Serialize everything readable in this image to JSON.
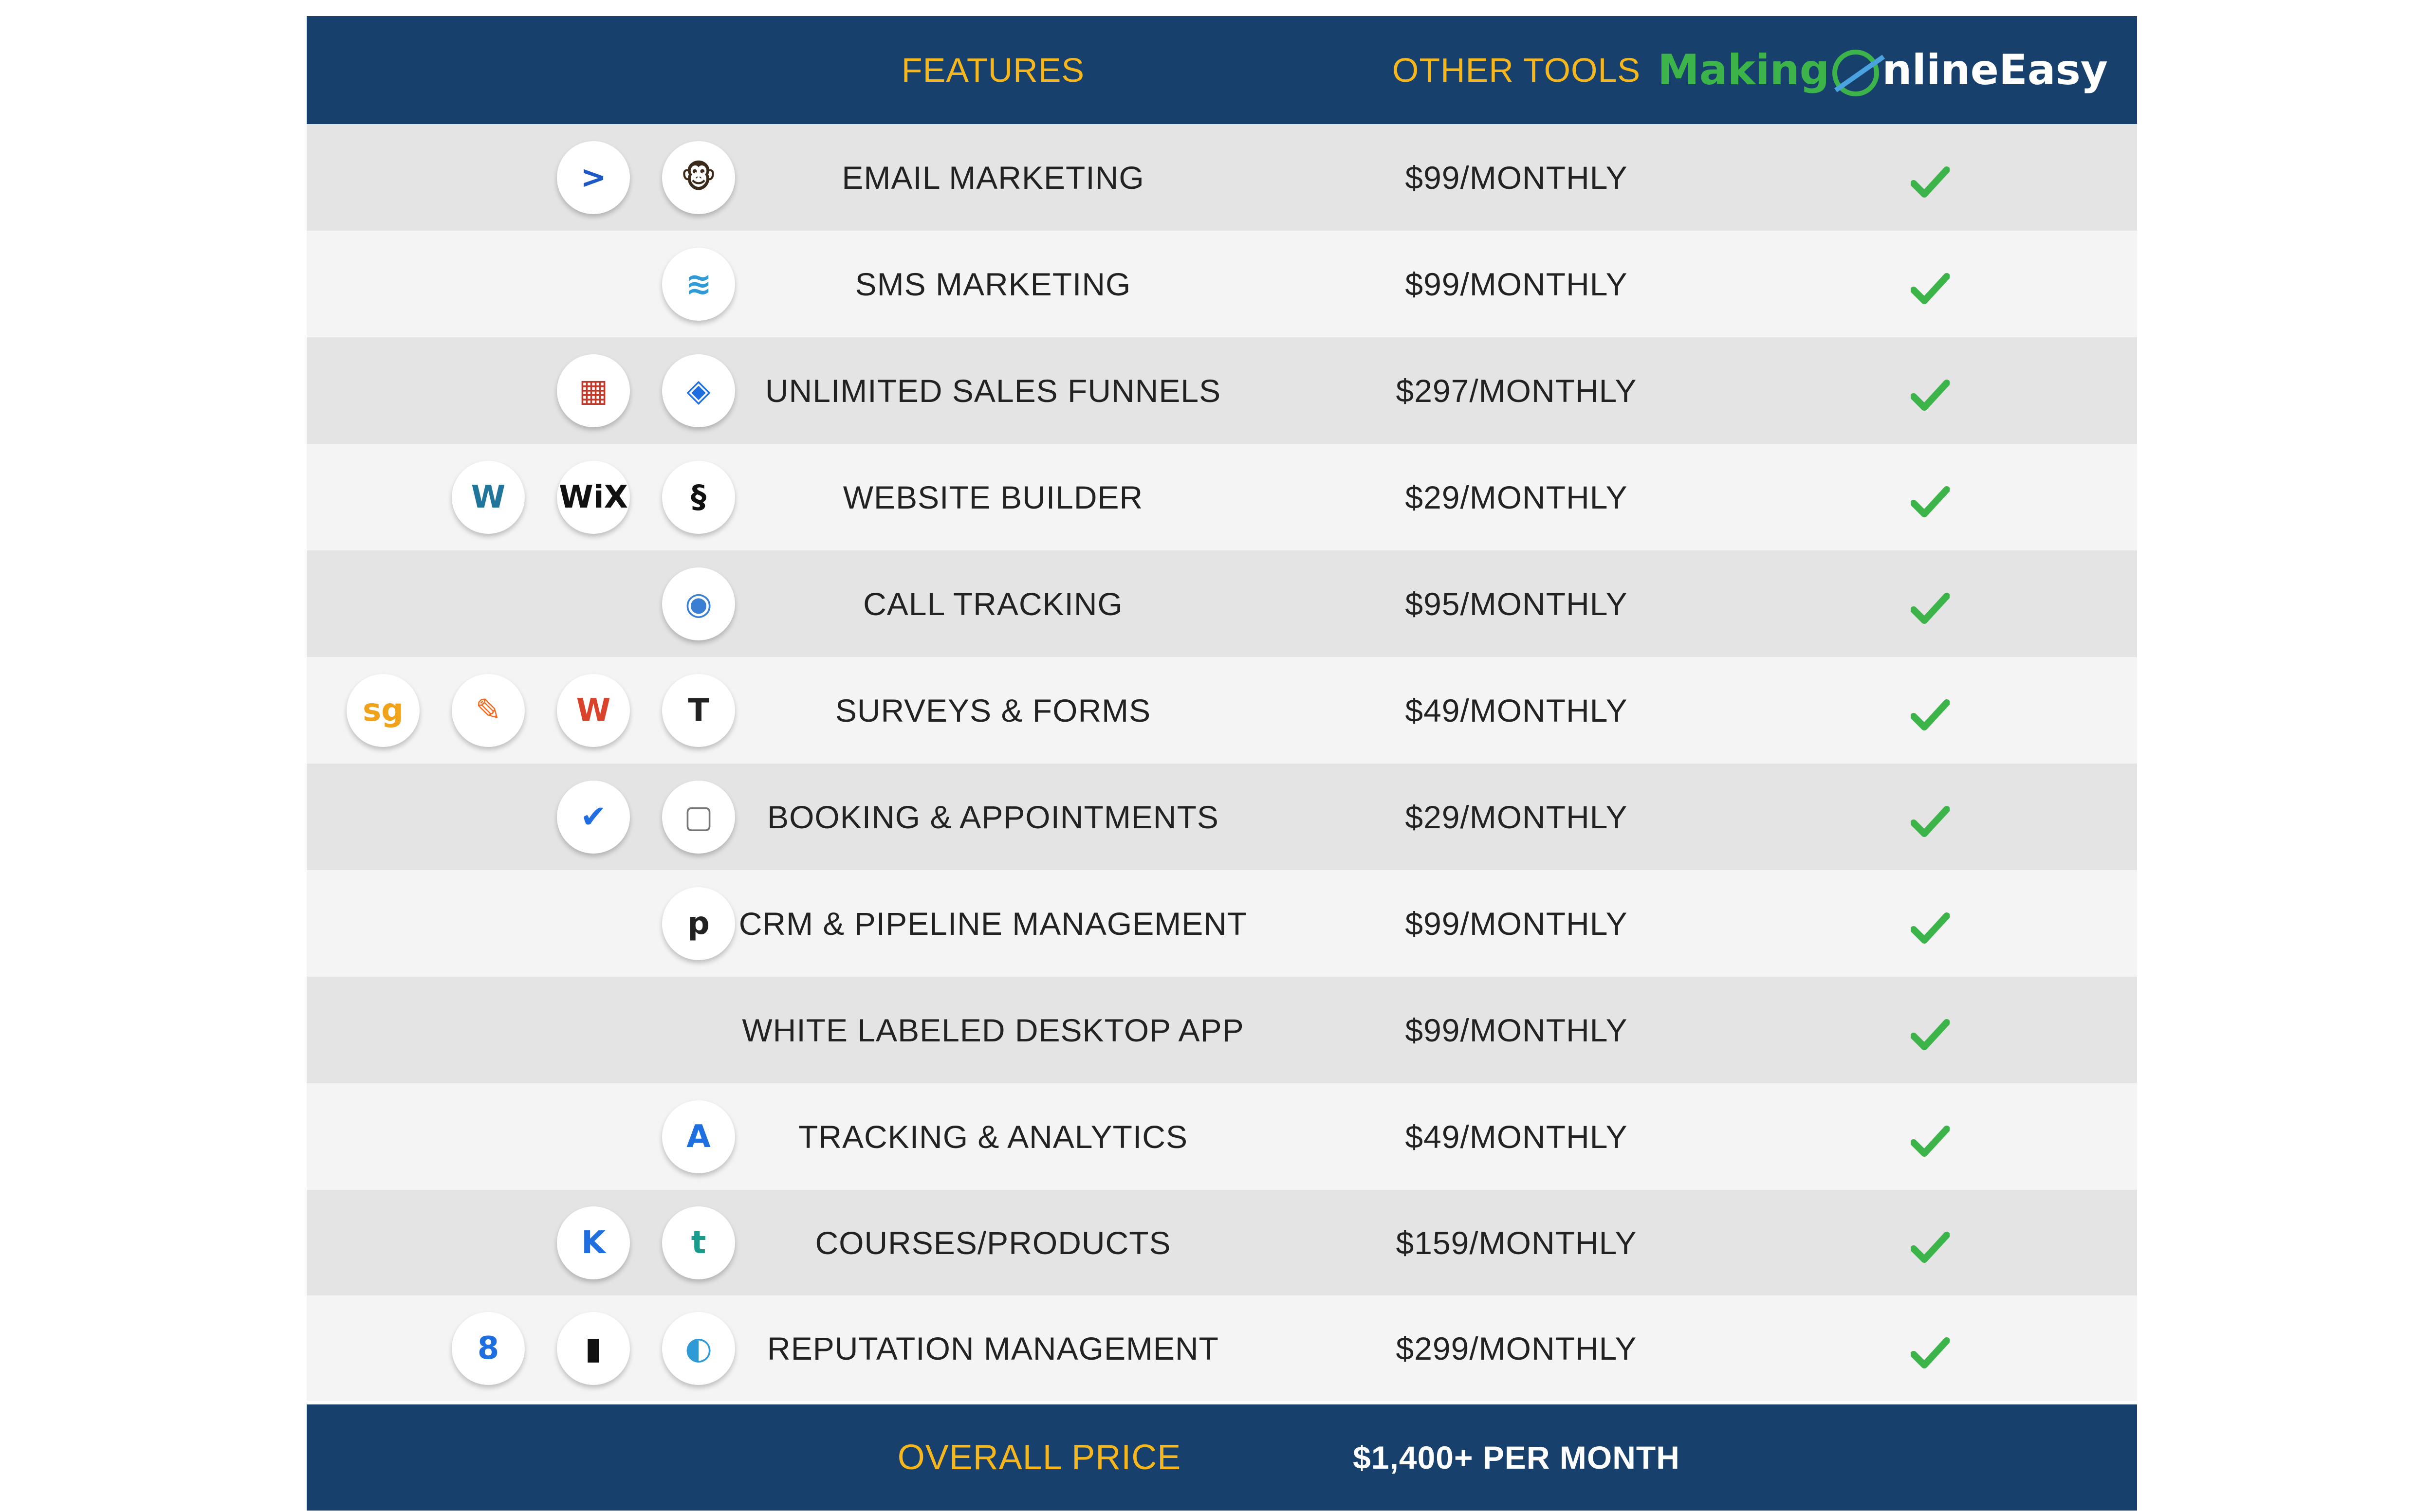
{
  "header": {
    "features_label": "FEATURES",
    "other_tools_label": "OTHER TOOLS",
    "brand": {
      "part1": "Making",
      "part2": "nlineEasy"
    }
  },
  "colors": {
    "header_bg": "#17406c",
    "header_text": "#f5b71d",
    "check": "#3cb449",
    "row_dark": "#e4e4e4",
    "row_light": "#f4f4f4"
  },
  "rows": [
    {
      "feature": "EMAIL MARKETING",
      "price": "$99/MONTHLY",
      "included": true,
      "icons": [
        {
          "name": "activecampaign-icon",
          "glyph": ">",
          "color": "#1d58c6"
        },
        {
          "name": "mailchimp-icon",
          "glyph": "🐵",
          "color": "#3b2a1a"
        }
      ]
    },
    {
      "feature": "SMS MARKETING",
      "price": "$99/MONTHLY",
      "included": true,
      "icons": [
        {
          "name": "layers-chevron-icon",
          "glyph": "≋",
          "color": "#2f9ad6"
        }
      ]
    },
    {
      "feature": "UNLIMITED SALES FUNNELS",
      "price": "$297/MONTHLY",
      "included": true,
      "icons": [
        {
          "name": "clickfunnels-icon",
          "glyph": "▦",
          "color": "#c0392b"
        },
        {
          "name": "layers-icon",
          "glyph": "◈",
          "color": "#1d6fe0"
        }
      ]
    },
    {
      "feature": "WEBSITE BUILDER",
      "price": "$29/MONTHLY",
      "included": true,
      "icons": [
        {
          "name": "wordpress-icon",
          "glyph": "W",
          "color": "#21759b"
        },
        {
          "name": "wix-icon",
          "glyph": "WiX",
          "color": "#111111"
        },
        {
          "name": "squarespace-icon",
          "glyph": "§",
          "color": "#111111"
        }
      ]
    },
    {
      "feature": "CALL TRACKING",
      "price": "$95/MONTHLY",
      "included": true,
      "icons": [
        {
          "name": "call-tracking-icon",
          "glyph": "◉",
          "color": "#3b7fd4"
        }
      ]
    },
    {
      "feature": "SURVEYS & FORMS",
      "price": "$49/MONTHLY",
      "included": true,
      "icons": [
        {
          "name": "surveygizmo-icon",
          "glyph": "sg",
          "color": "#f0a21b"
        },
        {
          "name": "jotform-icon",
          "glyph": "✎",
          "color": "#f26b21"
        },
        {
          "name": "wufoo-icon",
          "glyph": "W",
          "color": "#d9432b"
        },
        {
          "name": "typeform-icon",
          "glyph": "T",
          "color": "#222222"
        }
      ]
    },
    {
      "feature": "BOOKING & APPOINTMENTS",
      "price": "$29/MONTHLY",
      "included": true,
      "icons": [
        {
          "name": "acuity-check-icon",
          "glyph": "✔",
          "color": "#1f6fe0"
        },
        {
          "name": "calendar-icon",
          "glyph": "▢",
          "color": "#777777"
        }
      ]
    },
    {
      "feature": "CRM & PIPELINE MANAGEMENT",
      "price": "$99/MONTHLY",
      "included": true,
      "icons": [
        {
          "name": "pipedrive-icon",
          "glyph": "p",
          "color": "#222222"
        }
      ]
    },
    {
      "feature": "WHITE LABELED DESKTOP APP",
      "price": "$99/MONTHLY",
      "included": true,
      "icons": []
    },
    {
      "feature": "TRACKING & ANALYTICS",
      "price": "$49/MONTHLY",
      "included": true,
      "icons": [
        {
          "name": "analytics-a-icon",
          "glyph": "A",
          "color": "#1f6fe0"
        }
      ]
    },
    {
      "feature": "COURSES/PRODUCTS",
      "price": "$159/MONTHLY",
      "included": true,
      "icons": [
        {
          "name": "kajabi-icon",
          "glyph": "K",
          "color": "#1f6fe0"
        },
        {
          "name": "teachable-icon",
          "glyph": "t",
          "color": "#1a9b8c"
        }
      ]
    },
    {
      "feature": "REPUTATION MANAGEMENT",
      "price": "$299/MONTHLY",
      "included": true,
      "icons": [
        {
          "name": "birdeye-icon",
          "glyph": "8",
          "color": "#1f6fe0"
        },
        {
          "name": "podium-icon",
          "glyph": "▮",
          "color": "#111111"
        },
        {
          "name": "reputation-icon",
          "glyph": "◐",
          "color": "#2f9ad6"
        }
      ]
    }
  ],
  "footer": {
    "label": "OVERALL PRICE",
    "price": "$1,400+ PER MONTH"
  }
}
